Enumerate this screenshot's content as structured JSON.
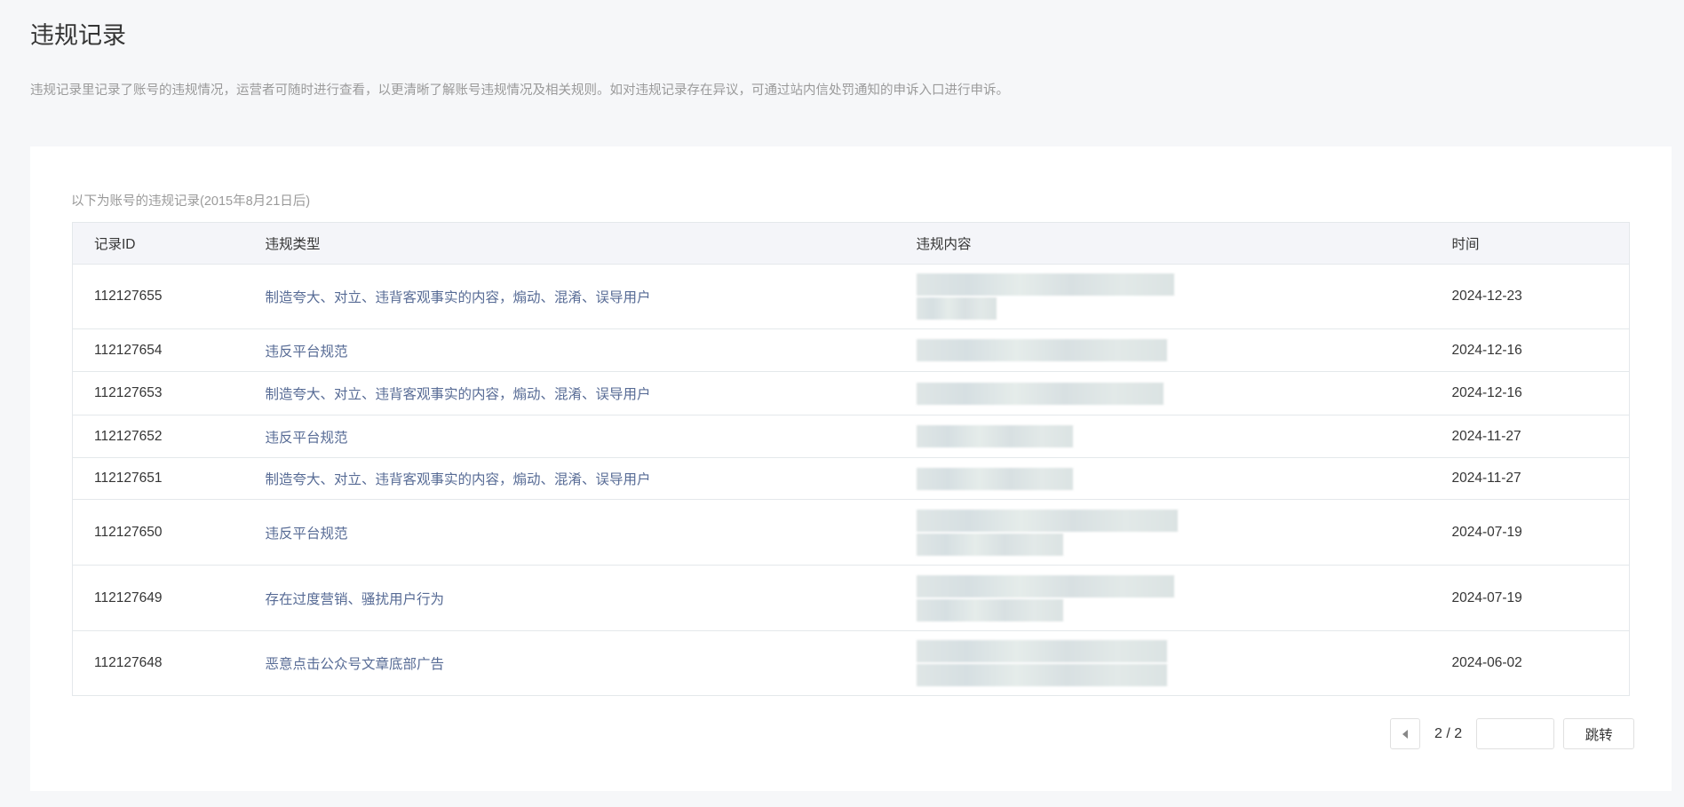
{
  "page": {
    "title": "违规记录",
    "description": "违规记录里记录了账号的违规情况，运营者可随时进行查看，以更清晰了解账号违规情况及相关规则。如对违规记录存在异议，可通过站内信处罚通知的申诉入口进行申诉。"
  },
  "records": {
    "subtitle": "以下为账号的违规记录(2015年8月21日后)",
    "columns": [
      "记录ID",
      "违规类型",
      "违规内容",
      "时间"
    ],
    "rows": [
      {
        "id": "112127655",
        "type": "制造夸大、对立、违背客观事实的内容，煽动、混淆、误导用户",
        "date": "2024-12-23"
      },
      {
        "id": "112127654",
        "type": "违反平台规范",
        "date": "2024-12-16"
      },
      {
        "id": "112127653",
        "type": "制造夸大、对立、违背客观事实的内容，煽动、混淆、误导用户",
        "date": "2024-12-16"
      },
      {
        "id": "112127652",
        "type": "违反平台规范",
        "date": "2024-11-27"
      },
      {
        "id": "112127651",
        "type": "制造夸大、对立、违背客观事实的内容，煽动、混淆、误导用户",
        "date": "2024-11-27"
      },
      {
        "id": "112127650",
        "type": "违反平台规范",
        "date": "2024-07-19"
      },
      {
        "id": "112127649",
        "type": "存在过度营销、骚扰用户行为",
        "date": "2024-07-19"
      },
      {
        "id": "112127648",
        "type": "恶意点击公众号文章底部广告",
        "date": "2024-06-02"
      }
    ]
  },
  "pagination": {
    "page_info": "2 / 2",
    "jump_input": "",
    "jump_label": "跳转"
  }
}
